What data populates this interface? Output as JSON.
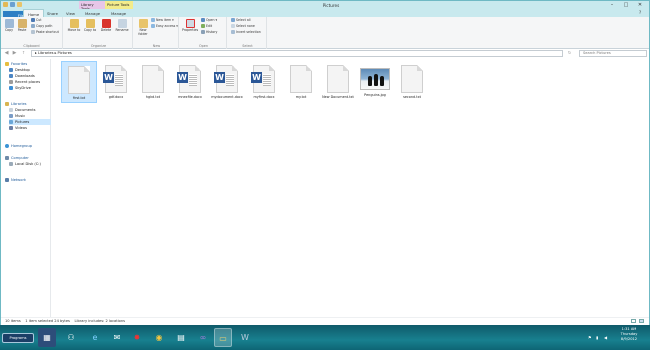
{
  "window": {
    "title": "Pictures",
    "ctx_tab1": "Library Tools",
    "ctx_tab2": "Picture Tools"
  },
  "tabs": [
    "File",
    "Home",
    "Share",
    "View",
    "Manage",
    "Manage"
  ],
  "ribbon": {
    "clipboard": {
      "copy": "Copy",
      "paste": "Paste",
      "cut": "Cut",
      "copy_path": "Copy path",
      "paste_shortcut": "Paste shortcut",
      "label": "Clipboard"
    },
    "organize": {
      "move_to": "Move to",
      "copy_to": "Copy to",
      "delete": "Delete",
      "rename": "Rename",
      "label": "Organize"
    },
    "new": {
      "new_folder": "New folder",
      "new_item": "New item ▾",
      "easy_access": "Easy access ▾",
      "label": "New"
    },
    "open": {
      "properties": "Properties",
      "open": "Open ▾",
      "edit": "Edit",
      "history": "History",
      "label": "Open"
    },
    "select": {
      "select_all": "Select all",
      "select_none": "Select none",
      "invert": "Invert selection",
      "label": "Select"
    }
  },
  "address": {
    "path": "▸ Libraries ▸ Pictures",
    "search_placeholder": "Search Pictures"
  },
  "nav": {
    "favorites": "Favorites",
    "desktop": "Desktop",
    "downloads": "Downloads",
    "recent": "Recent places",
    "skydrive": "SkyDrive",
    "libraries": "Libraries",
    "documents": "Documents",
    "music": "Music",
    "pictures": "Pictures",
    "videos": "Videos",
    "homegroup": "Homegroup",
    "computer": "Computer",
    "local_disk": "Local Disk (C:)",
    "network": "Network"
  },
  "files": [
    {
      "name": "first.txt",
      "type": "txt"
    },
    {
      "name": "gdf.docx",
      "type": "docx"
    },
    {
      "name": "hgkd.txt",
      "type": "txt"
    },
    {
      "name": "mnexfile.docx",
      "type": "docx"
    },
    {
      "name": "mydocument.docx",
      "type": "docx"
    },
    {
      "name": "myfirst.docx",
      "type": "docx"
    },
    {
      "name": "my.txt",
      "type": "txt"
    },
    {
      "name": "New Document.txt",
      "type": "txt"
    },
    {
      "name": "Penguins.jpg",
      "type": "jpg"
    },
    {
      "name": "second.txt",
      "type": "txt"
    }
  ],
  "status": {
    "items": "10 items",
    "selected": "1 item selected  24 bytes",
    "library": "Library includes: 2 locations"
  },
  "taskbar": {
    "start": "Programs",
    "time": "1:31 AM",
    "day": "Thursday",
    "date": "8/9/2012"
  }
}
